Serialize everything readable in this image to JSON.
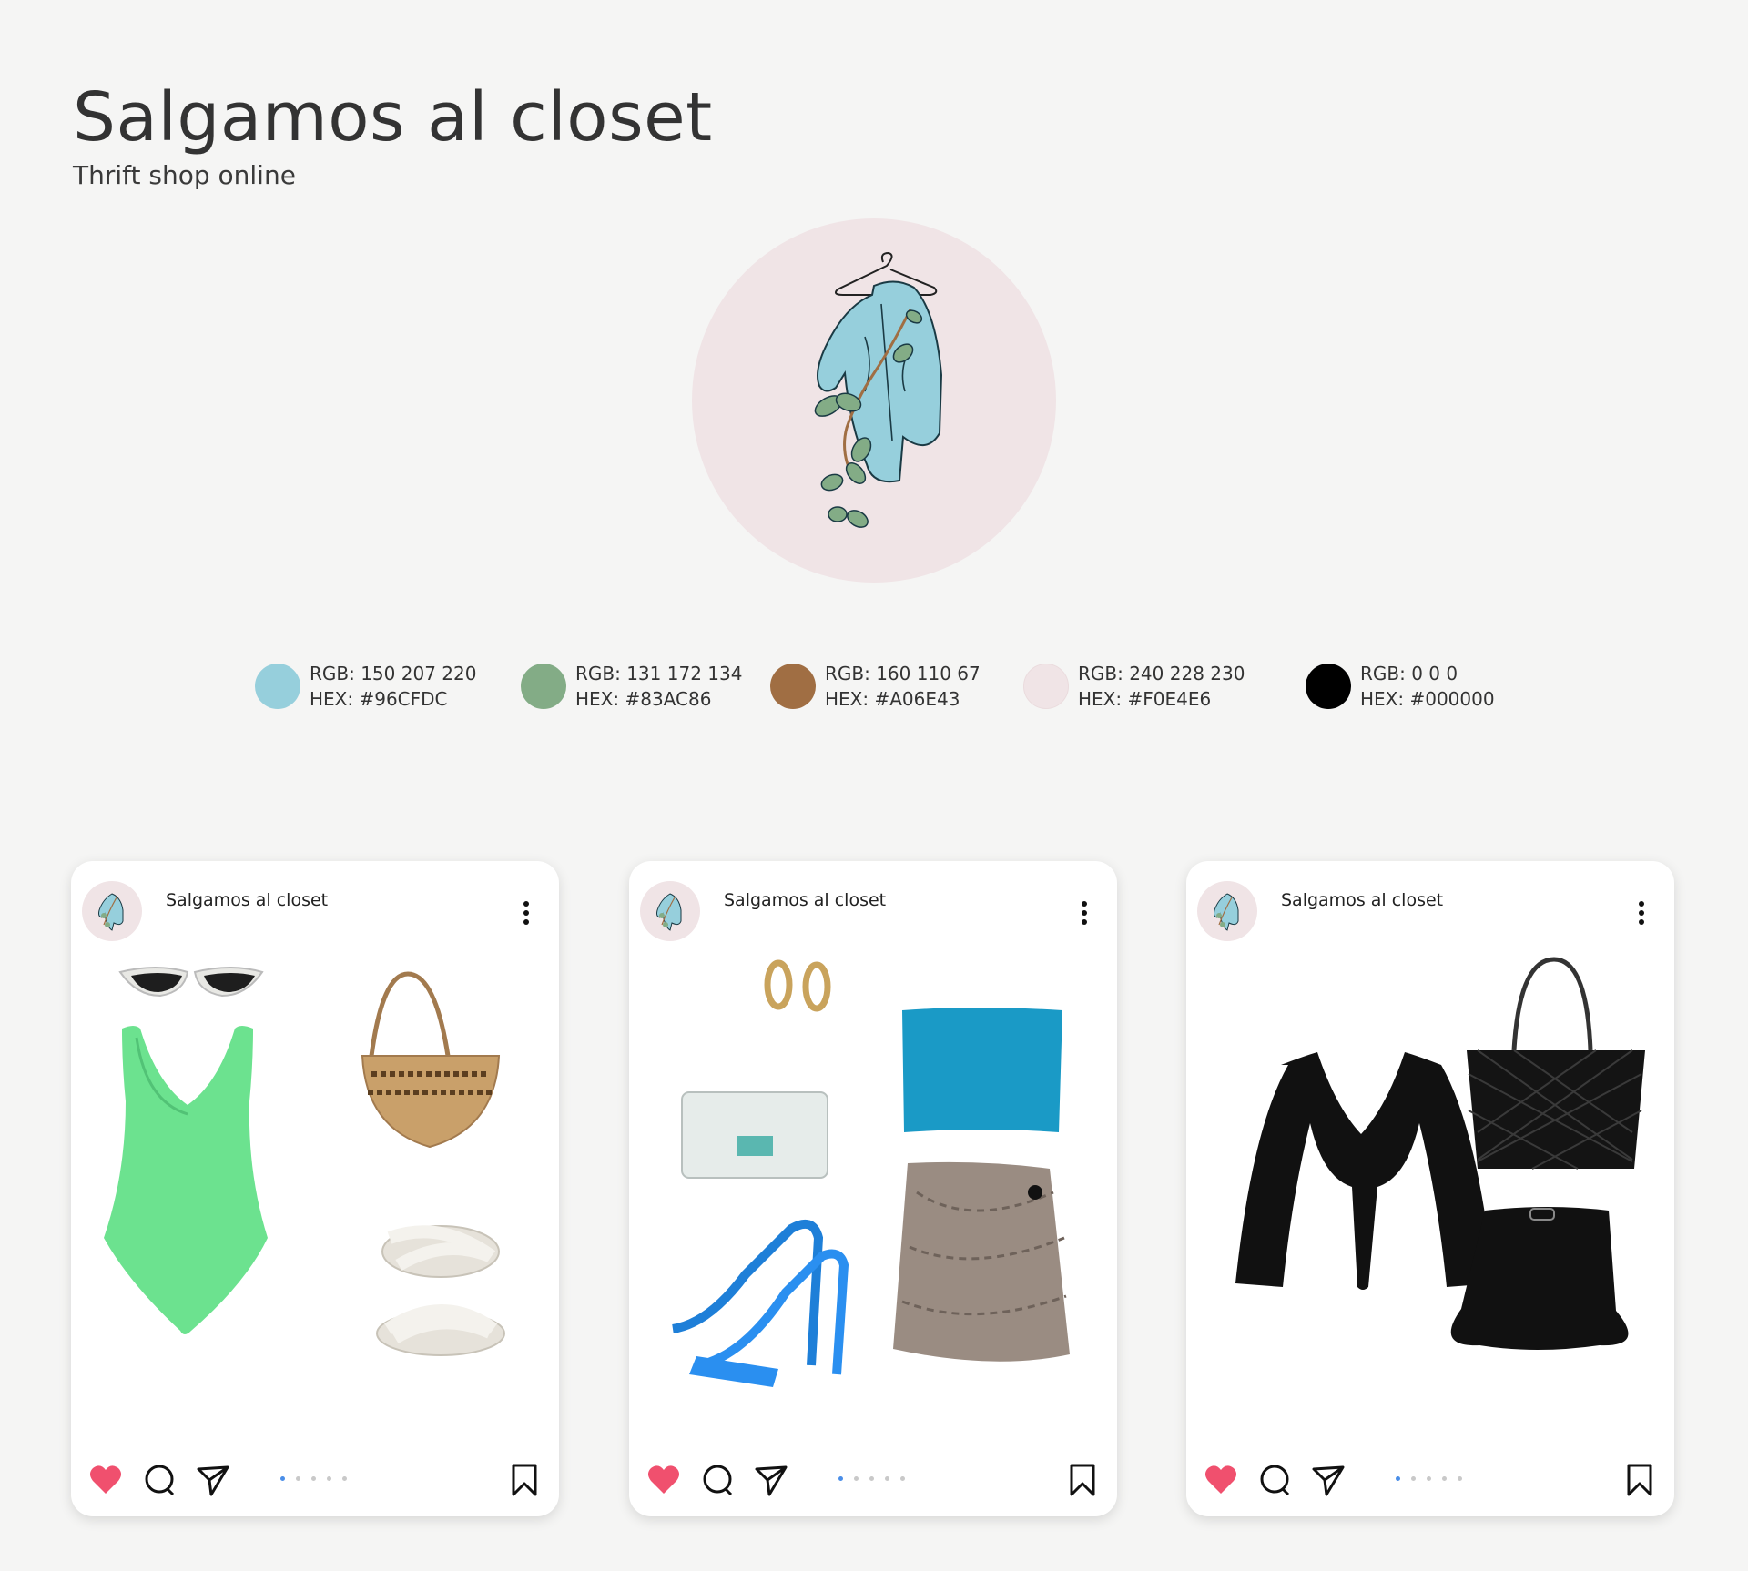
{
  "header": {
    "title": "Salgamos al closet",
    "subtitle": "Thrift shop online"
  },
  "palette": [
    {
      "color": "#96CFDC",
      "rgb": "RGB: 150 207 220",
      "hex": "HEX: #96CFDC"
    },
    {
      "color": "#83AC86",
      "rgb": "RGB: 131 172 134",
      "hex": "HEX: #83AC86"
    },
    {
      "color": "#A06E43",
      "rgb": "RGB: 160 110 67",
      "hex": "HEX: #A06E43"
    },
    {
      "color": "#F0E4E6",
      "rgb": "RGB: 240 228 230",
      "hex": "HEX: #F0E4E6"
    },
    {
      "color": "#000000",
      "rgb": "RGB: 0 0 0",
      "hex": "HEX: #000000"
    }
  ],
  "posts": [
    {
      "account": "Salgamos al closet",
      "items": [
        "cat-eye-sunglasses",
        "green-swimsuit",
        "wicker-basket-bag",
        "white-puffy-sandals"
      ],
      "carousel_total": 5,
      "carousel_active": 1
    },
    {
      "account": "Salgamos al closet",
      "items": [
        "gold-hoop-earrings",
        "white-wallet",
        "blue-tube-top",
        "blue-heeled-sandals",
        "snakeskin-skort"
      ],
      "carousel_total": 5,
      "carousel_active": 1
    },
    {
      "account": "Salgamos al closet",
      "items": [
        "black-tie-top",
        "black-quilted-tote",
        "black-flared-skirt"
      ],
      "carousel_total": 5,
      "carousel_active": 1
    }
  ],
  "icons": {
    "like": "heart-icon",
    "comment": "comment-icon",
    "share": "send-icon",
    "save": "bookmark-icon",
    "more": "more-vertical-icon"
  },
  "colors": {
    "like": "#F0506E",
    "carousel_active": "#4a8ee8",
    "carousel_inactive": "#c9c9c9"
  }
}
